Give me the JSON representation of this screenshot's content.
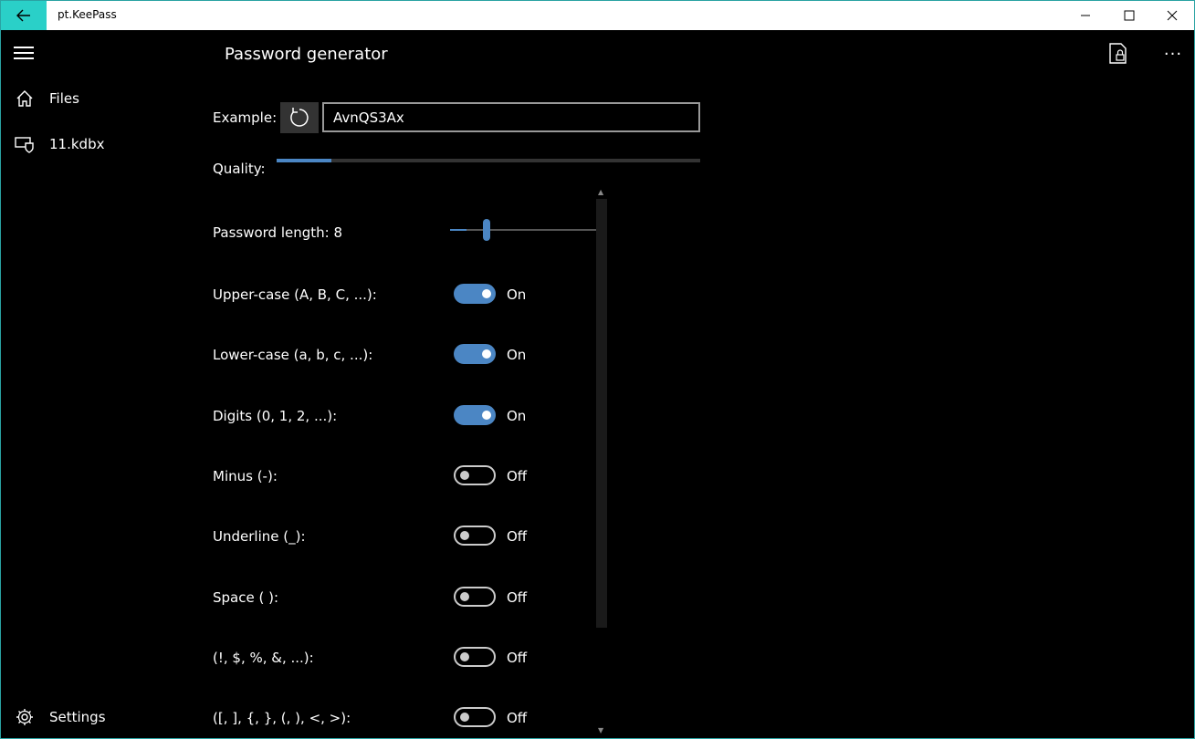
{
  "window": {
    "title": "pt.KeePass"
  },
  "nav": {
    "items": [
      {
        "label": "Files",
        "icon": "home-icon"
      },
      {
        "label": "11.kdbx",
        "icon": "database-shield-icon"
      }
    ],
    "settings_label": "Settings"
  },
  "page": {
    "title": "Password generator"
  },
  "example": {
    "label": "Example:",
    "value": "AvnQS3Ax"
  },
  "quality": {
    "label": "Quality:",
    "value": 0.13
  },
  "length": {
    "label": "Password length: 8",
    "value": 8,
    "min": 3,
    "max": 64
  },
  "options": [
    {
      "label": "Upper-case (A, B, C, ...):",
      "state": "On",
      "on": true
    },
    {
      "label": "Lower-case (a, b, c, ...):",
      "state": "On",
      "on": true
    },
    {
      "label": "Digits (0, 1, 2, ...):",
      "state": "On",
      "on": true
    },
    {
      "label": "Minus (-):",
      "state": "Off",
      "on": false
    },
    {
      "label": "Underline (_):",
      "state": "Off",
      "on": false
    },
    {
      "label": "Space ( ):",
      "state": "Off",
      "on": false
    },
    {
      "label": "(!, $, %, &, ...):",
      "state": "Off",
      "on": false
    },
    {
      "label": "([, ], {, }, (, ), <, >):",
      "state": "Off",
      "on": false
    }
  ],
  "colors": {
    "accent": "#4b86c4",
    "titlebar_accent": "#2ad0c8",
    "background": "#000000"
  }
}
